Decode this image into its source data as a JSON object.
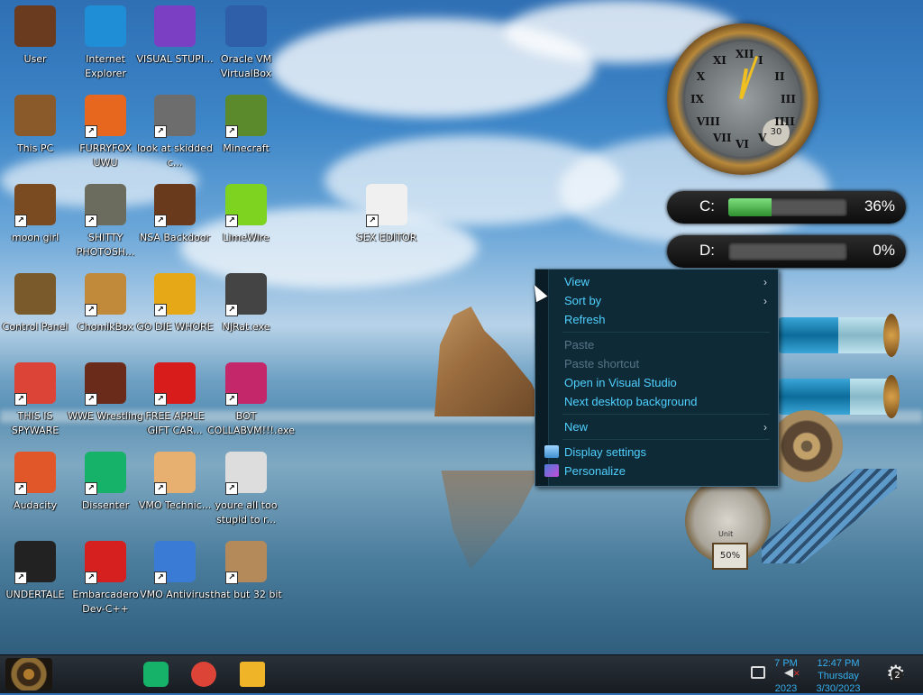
{
  "desktop": {
    "icons": [
      {
        "label": "User",
        "icon": "user-folder-icon",
        "color": "#6b3b1f"
      },
      {
        "label": "Internet Explorer",
        "icon": "edge-browser-icon",
        "color": "#1f8ed6"
      },
      {
        "label": "VISUAL STUPI...",
        "icon": "visual-studio-icon",
        "color": "#7b3fc4"
      },
      {
        "label": "Oracle VM VirtualBox",
        "icon": "virtualbox-icon",
        "color": "#2f5fa8"
      },
      {
        "label": "This PC",
        "icon": "computer-icon",
        "color": "#8a5a2a"
      },
      {
        "label": "FURRYFOX UWU",
        "icon": "firefox-icon",
        "color": "#e8671f"
      },
      {
        "label": "look at skidded c...",
        "icon": "copy-files-icon",
        "color": "#6d6d6d"
      },
      {
        "label": "Minecraft",
        "icon": "minecraft-icon",
        "color": "#5a8a2c"
      },
      {
        "label": "moon girl",
        "icon": "file-cabinet-icon",
        "color": "#7a4a20"
      },
      {
        "label": "SHITTY PHOTOSH...",
        "icon": "gimp-icon",
        "color": "#6c6c5e"
      },
      {
        "label": "NSA Backdoor",
        "icon": "radio-icon",
        "color": "#6a3a1c"
      },
      {
        "label": "LimeWire",
        "icon": "limewire-icon",
        "color": "#7ed321"
      },
      {
        "label": "SEX EDITOR",
        "icon": "hxd-editor-icon",
        "color": "#f0f0f0"
      },
      {
        "label": "Control Panel",
        "icon": "control-panel-icon",
        "color": "#7a5a2a"
      },
      {
        "label": "ChomikBox",
        "icon": "chomikbox-icon",
        "color": "#c08a3a"
      },
      {
        "label": "GO DIE WHORE",
        "icon": "de-app-icon",
        "color": "#e6a817"
      },
      {
        "label": "NjRat.exe",
        "icon": "skull-icon",
        "color": "#444444"
      },
      {
        "label": "THIS IS SPYWARE",
        "icon": "chrome-icon",
        "color": "#db4437"
      },
      {
        "label": "WWE Wrestling",
        "icon": "stove-icon",
        "color": "#6b2b1a"
      },
      {
        "label": "FREE APPLE GIFT CAR...",
        "icon": "apple-icon",
        "color": "#d81b1b"
      },
      {
        "label": "BOT COLLABVM!!!.exe",
        "icon": "monitor-app-icon",
        "color": "#c4286a"
      },
      {
        "label": "Audacity",
        "icon": "audacity-icon",
        "color": "#e2572a"
      },
      {
        "label": "Dissenter",
        "icon": "dissenter-icon",
        "color": "#17b26a"
      },
      {
        "label": "VMO Technic...",
        "icon": "technician-icon",
        "color": "#e8b070"
      },
      {
        "label": "youre all too stupid to r...",
        "icon": "portrait-icon",
        "color": "#dddddd"
      },
      {
        "label": "UNDERTALE",
        "icon": "unity-icon",
        "color": "#222222"
      },
      {
        "label": "Embarcadero Dev-C++",
        "icon": "devcpp-icon",
        "color": "#d62020"
      },
      {
        "label": "VMO Antivirus",
        "icon": "shield-icon",
        "color": "#3a7bd5"
      },
      {
        "label": "that but 32 bit",
        "icon": "portrait-icon",
        "color": "#b58a5a"
      }
    ]
  },
  "gadgets": {
    "clock": {
      "numerals": [
        "XII",
        "I",
        "II",
        "III",
        "IIII",
        "V",
        "VI",
        "VII",
        "VIII",
        "IX",
        "X",
        "XI"
      ],
      "sub_dial": "30"
    },
    "drives": [
      {
        "letter": "C:",
        "percent_label": "36%",
        "fill_fraction": 0.36
      },
      {
        "letter": "D:",
        "percent_label": "0%",
        "fill_fraction": 0.0
      }
    ],
    "tubes": [
      {
        "fill_fraction": 0.52
      },
      {
        "fill_fraction": 0.62
      }
    ],
    "steam_gauge_label": "Unit",
    "pressure_label": "50%"
  },
  "context_menu": {
    "items": [
      {
        "label": "View",
        "submenu": true,
        "disabled": false
      },
      {
        "label": "Sort by",
        "submenu": true,
        "disabled": false
      },
      {
        "label": "Refresh",
        "submenu": false,
        "disabled": false
      },
      {
        "label": "Paste",
        "submenu": false,
        "disabled": true
      },
      {
        "label": "Paste shortcut",
        "submenu": false,
        "disabled": true
      },
      {
        "label": "Open in Visual Studio",
        "submenu": false,
        "disabled": false
      },
      {
        "label": "Next desktop background",
        "submenu": false,
        "disabled": false
      },
      {
        "label": "New",
        "submenu": true,
        "disabled": false
      },
      {
        "label": "Display settings",
        "submenu": false,
        "disabled": false,
        "icon": "display-icon"
      },
      {
        "label": "Personalize",
        "submenu": false,
        "disabled": false,
        "icon": "personalize-icon"
      }
    ],
    "submenu_glyph": "›"
  },
  "taskbar": {
    "pinned": [
      {
        "name": "dissenter",
        "color": "#17b26a"
      },
      {
        "name": "chrome",
        "color": "#db4437"
      },
      {
        "name": "file-explorer",
        "color": "#f0b429"
      }
    ],
    "tray": {
      "left_time": "7 PM",
      "left_year": "2023",
      "time": "12:47 PM",
      "day": "Thursday",
      "date": "3/30/2023",
      "notification_count": "2"
    },
    "accent": "#35b0f0"
  }
}
